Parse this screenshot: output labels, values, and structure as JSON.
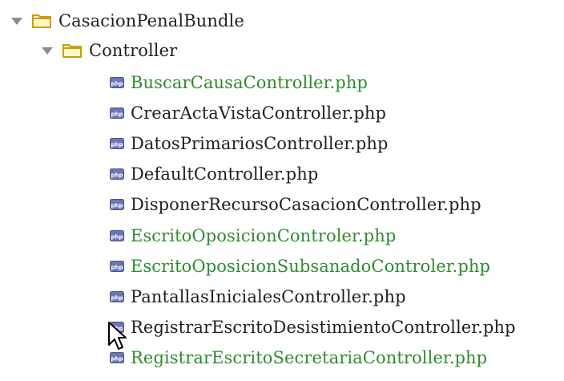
{
  "tree": {
    "root": {
      "label": "CasacionPenalBundle",
      "icon": "folder-icon",
      "expanded": true
    },
    "folder": {
      "label": "Controller",
      "icon": "folder-icon",
      "expanded": true
    },
    "files": [
      {
        "label": "BuscarCausaController.php",
        "status": "modified",
        "icon": "php-file-icon"
      },
      {
        "label": "CrearActaVistaController.php",
        "status": "normal",
        "icon": "php-file-icon"
      },
      {
        "label": "DatosPrimariosController.php",
        "status": "normal",
        "icon": "php-file-icon"
      },
      {
        "label": "DefaultController.php",
        "status": "normal",
        "icon": "php-file-icon"
      },
      {
        "label": "DisponerRecursoCasacionController.php",
        "status": "normal",
        "icon": "php-file-icon"
      },
      {
        "label": "EscritoOposicionControler.php",
        "status": "modified",
        "icon": "php-file-icon"
      },
      {
        "label": "EscritoOposicionSubsanadoControler.php",
        "status": "modified",
        "icon": "php-file-icon"
      },
      {
        "label": "PantallasInicialesController.php",
        "status": "normal",
        "icon": "php-file-icon"
      },
      {
        "label": "RegistrarEscritoDesistimientoController.php",
        "status": "normal",
        "icon": "php-file-icon"
      },
      {
        "label": "RegistrarEscritoSecretariaController.php",
        "status": "modified",
        "icon": "php-file-icon"
      }
    ]
  },
  "colors": {
    "modified": "#2e8b2e",
    "normal": "#1f1f1f",
    "folder_stroke": "#c8a000",
    "folder_fill": "#fff6c8",
    "arrow": "#8c8c8c"
  },
  "cursor": {
    "icon": "mouse-pointer-icon"
  }
}
